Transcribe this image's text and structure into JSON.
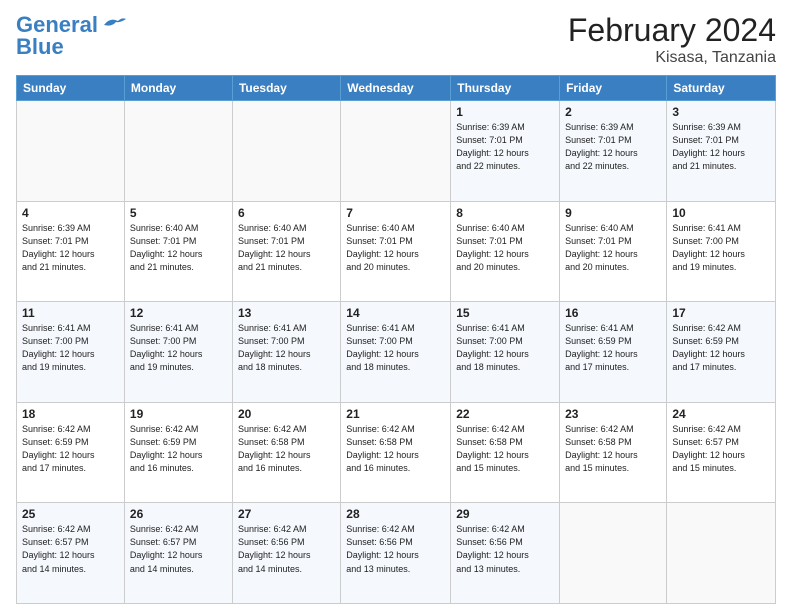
{
  "logo": {
    "line1": "General",
    "line2": "Blue"
  },
  "title": "February 2024",
  "subtitle": "Kisasa, Tanzania",
  "days_header": [
    "Sunday",
    "Monday",
    "Tuesday",
    "Wednesday",
    "Thursday",
    "Friday",
    "Saturday"
  ],
  "weeks": [
    [
      {
        "day": "",
        "info": ""
      },
      {
        "day": "",
        "info": ""
      },
      {
        "day": "",
        "info": ""
      },
      {
        "day": "",
        "info": ""
      },
      {
        "day": "1",
        "info": "Sunrise: 6:39 AM\nSunset: 7:01 PM\nDaylight: 12 hours\nand 22 minutes."
      },
      {
        "day": "2",
        "info": "Sunrise: 6:39 AM\nSunset: 7:01 PM\nDaylight: 12 hours\nand 22 minutes."
      },
      {
        "day": "3",
        "info": "Sunrise: 6:39 AM\nSunset: 7:01 PM\nDaylight: 12 hours\nand 21 minutes."
      }
    ],
    [
      {
        "day": "4",
        "info": "Sunrise: 6:39 AM\nSunset: 7:01 PM\nDaylight: 12 hours\nand 21 minutes."
      },
      {
        "day": "5",
        "info": "Sunrise: 6:40 AM\nSunset: 7:01 PM\nDaylight: 12 hours\nand 21 minutes."
      },
      {
        "day": "6",
        "info": "Sunrise: 6:40 AM\nSunset: 7:01 PM\nDaylight: 12 hours\nand 21 minutes."
      },
      {
        "day": "7",
        "info": "Sunrise: 6:40 AM\nSunset: 7:01 PM\nDaylight: 12 hours\nand 20 minutes."
      },
      {
        "day": "8",
        "info": "Sunrise: 6:40 AM\nSunset: 7:01 PM\nDaylight: 12 hours\nand 20 minutes."
      },
      {
        "day": "9",
        "info": "Sunrise: 6:40 AM\nSunset: 7:01 PM\nDaylight: 12 hours\nand 20 minutes."
      },
      {
        "day": "10",
        "info": "Sunrise: 6:41 AM\nSunset: 7:00 PM\nDaylight: 12 hours\nand 19 minutes."
      }
    ],
    [
      {
        "day": "11",
        "info": "Sunrise: 6:41 AM\nSunset: 7:00 PM\nDaylight: 12 hours\nand 19 minutes."
      },
      {
        "day": "12",
        "info": "Sunrise: 6:41 AM\nSunset: 7:00 PM\nDaylight: 12 hours\nand 19 minutes."
      },
      {
        "day": "13",
        "info": "Sunrise: 6:41 AM\nSunset: 7:00 PM\nDaylight: 12 hours\nand 18 minutes."
      },
      {
        "day": "14",
        "info": "Sunrise: 6:41 AM\nSunset: 7:00 PM\nDaylight: 12 hours\nand 18 minutes."
      },
      {
        "day": "15",
        "info": "Sunrise: 6:41 AM\nSunset: 7:00 PM\nDaylight: 12 hours\nand 18 minutes."
      },
      {
        "day": "16",
        "info": "Sunrise: 6:41 AM\nSunset: 6:59 PM\nDaylight: 12 hours\nand 17 minutes."
      },
      {
        "day": "17",
        "info": "Sunrise: 6:42 AM\nSunset: 6:59 PM\nDaylight: 12 hours\nand 17 minutes."
      }
    ],
    [
      {
        "day": "18",
        "info": "Sunrise: 6:42 AM\nSunset: 6:59 PM\nDaylight: 12 hours\nand 17 minutes."
      },
      {
        "day": "19",
        "info": "Sunrise: 6:42 AM\nSunset: 6:59 PM\nDaylight: 12 hours\nand 16 minutes."
      },
      {
        "day": "20",
        "info": "Sunrise: 6:42 AM\nSunset: 6:58 PM\nDaylight: 12 hours\nand 16 minutes."
      },
      {
        "day": "21",
        "info": "Sunrise: 6:42 AM\nSunset: 6:58 PM\nDaylight: 12 hours\nand 16 minutes."
      },
      {
        "day": "22",
        "info": "Sunrise: 6:42 AM\nSunset: 6:58 PM\nDaylight: 12 hours\nand 15 minutes."
      },
      {
        "day": "23",
        "info": "Sunrise: 6:42 AM\nSunset: 6:58 PM\nDaylight: 12 hours\nand 15 minutes."
      },
      {
        "day": "24",
        "info": "Sunrise: 6:42 AM\nSunset: 6:57 PM\nDaylight: 12 hours\nand 15 minutes."
      }
    ],
    [
      {
        "day": "25",
        "info": "Sunrise: 6:42 AM\nSunset: 6:57 PM\nDaylight: 12 hours\nand 14 minutes."
      },
      {
        "day": "26",
        "info": "Sunrise: 6:42 AM\nSunset: 6:57 PM\nDaylight: 12 hours\nand 14 minutes."
      },
      {
        "day": "27",
        "info": "Sunrise: 6:42 AM\nSunset: 6:56 PM\nDaylight: 12 hours\nand 14 minutes."
      },
      {
        "day": "28",
        "info": "Sunrise: 6:42 AM\nSunset: 6:56 PM\nDaylight: 12 hours\nand 13 minutes."
      },
      {
        "day": "29",
        "info": "Sunrise: 6:42 AM\nSunset: 6:56 PM\nDaylight: 12 hours\nand 13 minutes."
      },
      {
        "day": "",
        "info": ""
      },
      {
        "day": "",
        "info": ""
      }
    ]
  ]
}
